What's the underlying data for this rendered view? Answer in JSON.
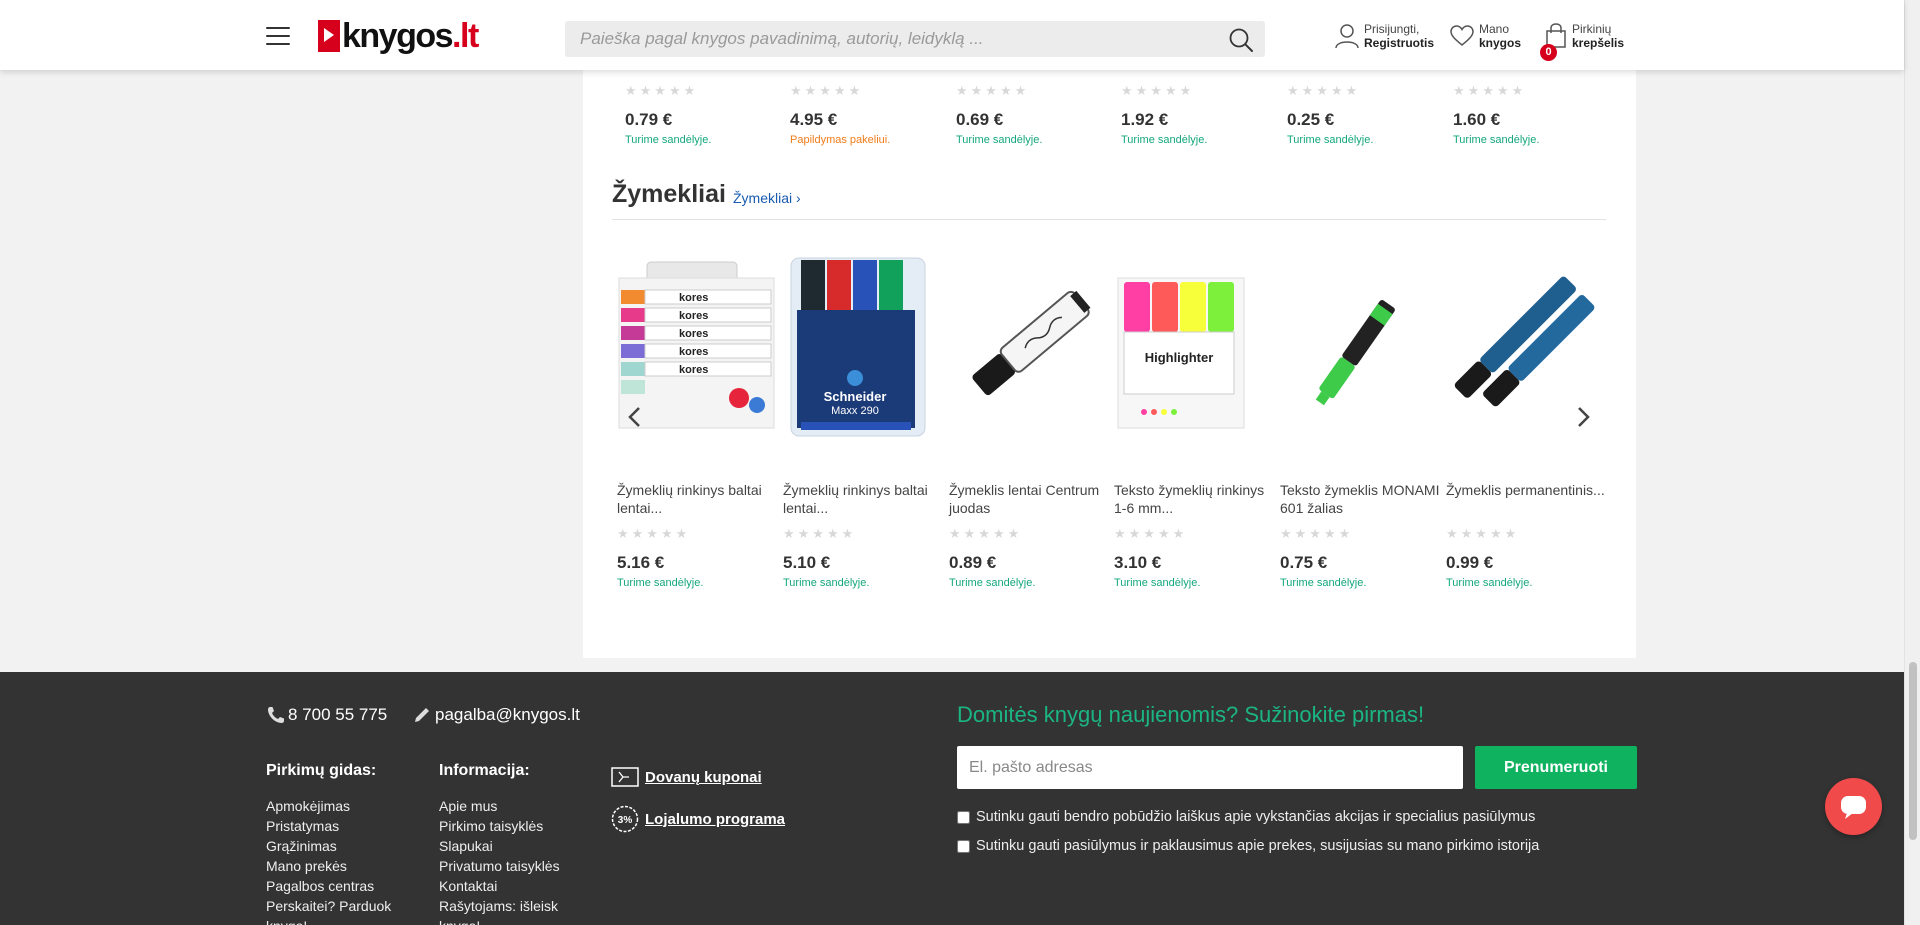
{
  "header": {
    "logo_text": "knygos",
    "logo_tld": ".lt",
    "search_placeholder": "Paieška pagal knygos pavadinimą, autorių, leidyklą ...",
    "login_line1": "Prisijungti,",
    "login_line2": "Registruotis",
    "wishlist_line1": "Mano",
    "wishlist_line2": "knygos",
    "cart_line1": "Pirkinių",
    "cart_line2": "krepšelis",
    "cart_count": "0"
  },
  "previous_row": [
    {
      "price": "0.79 €",
      "stock": "Turime sandėlyje.",
      "stock_status": "in-stock"
    },
    {
      "price": "4.95 €",
      "stock": "Papildymas pakeliui.",
      "stock_status": "restocking"
    },
    {
      "price": "0.69 €",
      "stock": "Turime sandėlyje.",
      "stock_status": "in-stock"
    },
    {
      "price": "1.92 €",
      "stock": "Turime sandėlyje.",
      "stock_status": "in-stock"
    },
    {
      "price": "0.25 €",
      "stock": "Turime sandėlyje.",
      "stock_status": "in-stock"
    },
    {
      "price": "1.60 €",
      "stock": "Turime sandėlyje.",
      "stock_status": "in-stock"
    }
  ],
  "section": {
    "title": "Žymekliai",
    "link": "Žymekliai ›"
  },
  "products": [
    {
      "name": "Žymeklių rinkinys baltai lentai...",
      "price": "5.16 €",
      "stock": "Turime sandėlyje.",
      "image": "kores-markers",
      "image_brand": "kores"
    },
    {
      "name": "Žymeklių rinkinys baltai lentai...",
      "price": "5.10 €",
      "stock": "Turime sandėlyje.",
      "image": "schneider-maxx-290",
      "image_brand": "Schneider",
      "image_model": "Maxx 290"
    },
    {
      "name": "Žymeklis lentai Centrum juodas",
      "price": "0.89 €",
      "stock": "Turime sandėlyje.",
      "image": "whiteboard-marker-black"
    },
    {
      "name": "Teksto žymeklių rinkinys 1-6 mm...",
      "price": "3.10 €",
      "stock": "Turime sandėlyje.",
      "image": "highlighter-set",
      "image_brand": "Highlighter"
    },
    {
      "name": "Teksto žymeklis MONAMI 601 žalias",
      "price": "0.75 €",
      "stock": "Turime sandėlyje.",
      "image": "green-highlighter"
    },
    {
      "name": "Žymeklis permanentinis...",
      "price": "0.99 €",
      "stock": "Turime sandėlyje.",
      "image": "permanent-marker-blue"
    }
  ],
  "rating_stars": "★★★★★",
  "footer": {
    "phone": "8 700 55 775",
    "email": "pagalba@knygos.lt",
    "col1_title": "Pirkimų gidas:",
    "col1_items": [
      "Apmokėjimas",
      "Pristatymas",
      "Grąžinimas",
      "Mano prekės",
      "Pagalbos centras",
      "Perskaitei? Parduok",
      "knygą!"
    ],
    "col2_title": "Informacija:",
    "col2_items": [
      "Apie mus",
      "Pirkimo taisyklės",
      "Slapukai",
      "Privatumo taisyklės",
      "Kontaktai",
      "Rašytojams: išleisk",
      "knygą!"
    ],
    "gift_label": "Dovanų kuponai",
    "loyalty_label": "Lojalumo programa",
    "loyalty_badge": "3%",
    "newsletter_title": "Domitės knygų naujienomis? Sužinokite pirmas!",
    "email_placeholder": "El. pašto adresas",
    "subscribe_label": "Prenumeruoti",
    "consent1": "Sutinku gauti bendro pobūdžio laiškus apie vykstančias akcijas ir specialius pasiūlymus",
    "consent2": "Sutinku gauti pasiūlymus ir paklausimus apie prekes, susijusias su mano pirkimo istorija"
  },
  "colors": {
    "brand_red": "#d6001c",
    "stock_green": "#14a77c",
    "stock_orange": "#f07c19",
    "subscribe_green": "#0fb25f",
    "newsletter_teal": "#1bb584",
    "footer_bg": "#333333",
    "chat_red": "#f04a4a"
  }
}
